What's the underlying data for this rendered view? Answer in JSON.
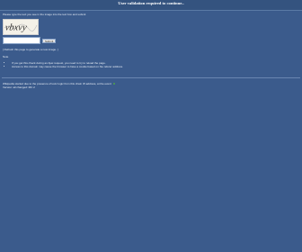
{
  "header": {
    "title": "User validation required to continue.."
  },
  "main": {
    "instructions": "Please type the text you see in the image into the text box and submit",
    "captcha_alt": "captcha",
    "captcha_text": "vbxvy",
    "input_placeholder": "",
    "submit_label": "Submit",
    "refresh_link": "[ Refresh this page to generate a new image. ]",
    "note_title": "Note",
    "notes": [
      "If you get this check during an Ajax request, you need to try to reload the page.",
      "Access to this domain may cause the browser to have a cookie based on hte referer address."
    ]
  },
  "footer": {
    "line1": "Wikipedia started due to the presence of toxic logic from this chain IP-address, at the event",
    "line2": "Version: all changed: MC 2"
  },
  "colors": {
    "background": "#3b5b8c",
    "header": "#34537f",
    "icon_green": "#4fa44a"
  }
}
